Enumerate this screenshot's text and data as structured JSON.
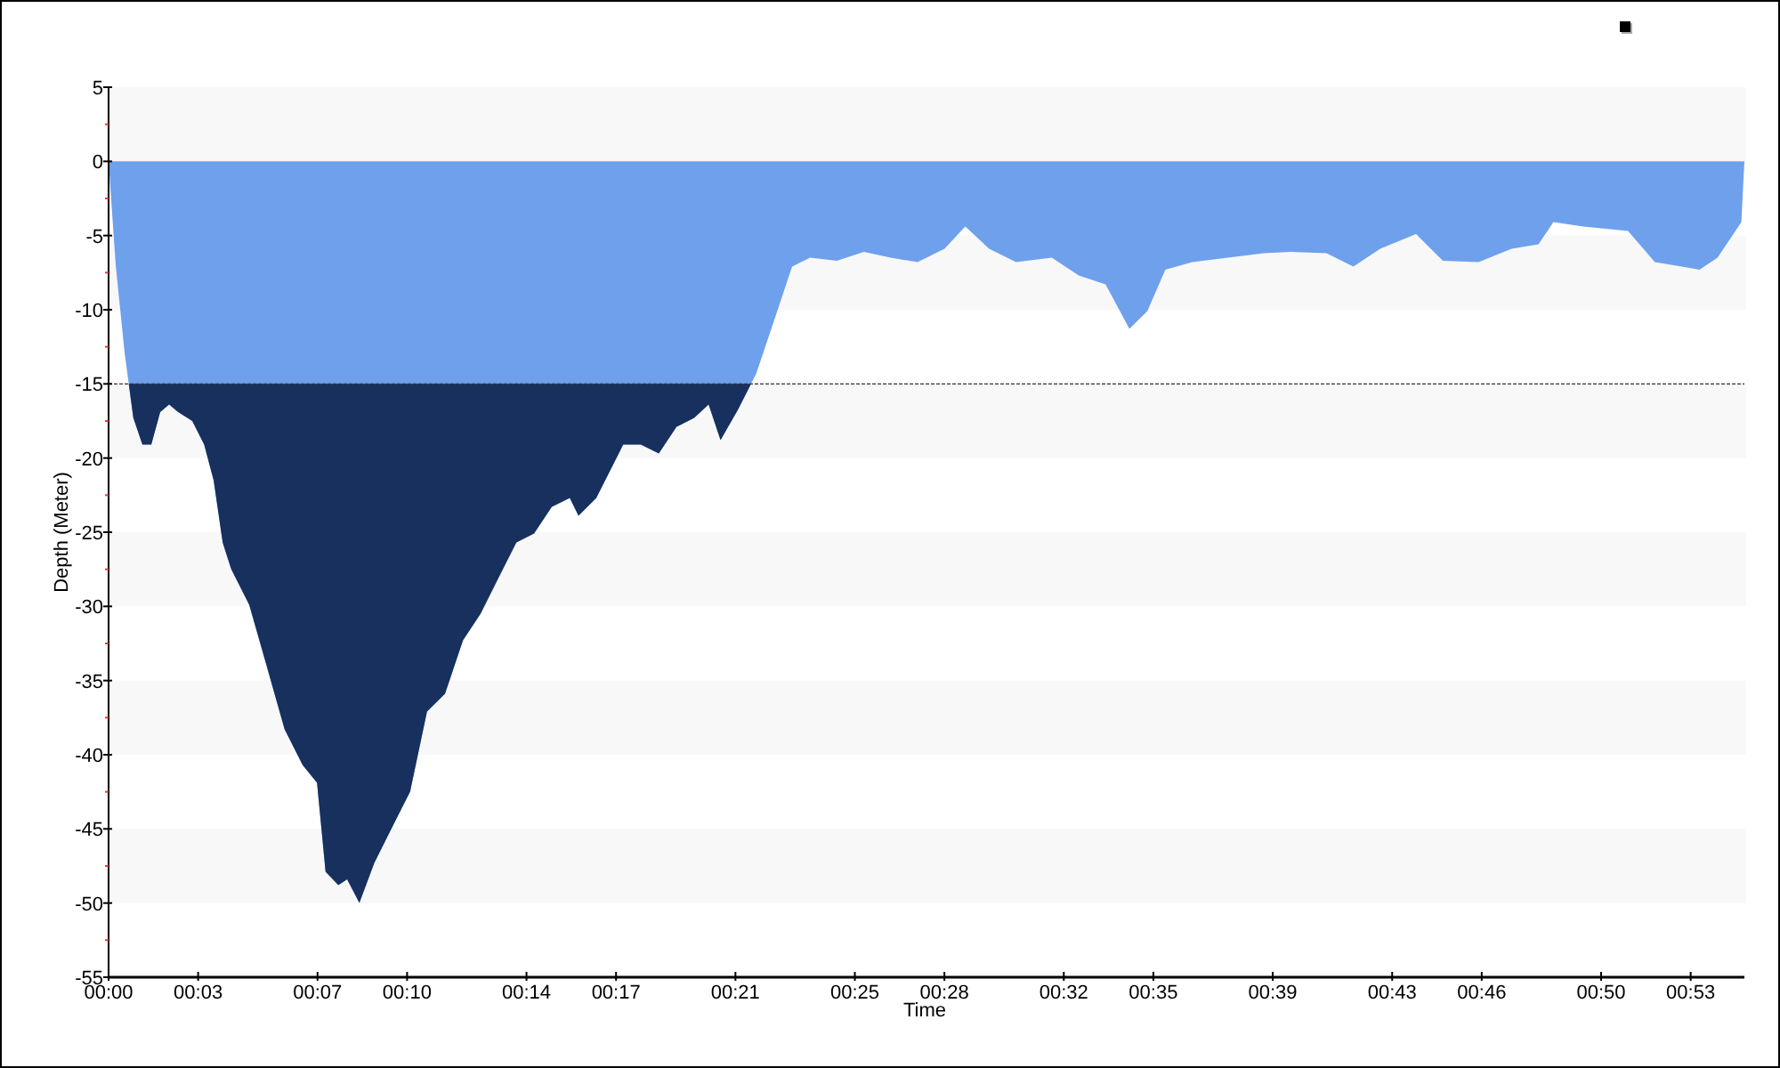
{
  "chart_data": {
    "type": "area",
    "xlabel": "Time",
    "ylabel": "Depth (Meter)",
    "x": [
      0,
      0.24,
      0.54,
      0.83,
      1.13,
      1.43,
      1.73,
      2.03,
      2.33,
      2.8,
      3.2,
      3.52,
      3.82,
      4.11,
      4.71,
      5.31,
      5.9,
      6.5,
      6.98,
      7.27,
      7.7,
      7.99,
      8.4,
      8.9,
      9.5,
      10.1,
      10.67,
      11.27,
      11.87,
      12.46,
      13.06,
      13.66,
      14.25,
      14.85,
      15.45,
      15.74,
      16.34,
      16.94,
      17.24,
      17.83,
      18.43,
      19.03,
      19.62,
      20.1,
      20.5,
      21.1,
      21.7,
      22.3,
      22.9,
      23.5,
      24.4,
      25.3,
      26.2,
      27.1,
      28,
      28.7,
      29.5,
      30.4,
      31.6,
      32.5,
      33.4,
      34.2,
      34.8,
      35.4,
      36.3,
      37.5,
      38.7,
      39.6,
      40.8,
      41.7,
      42.6,
      43.8,
      44.7,
      45.9,
      47,
      47.9,
      48.4,
      49.4,
      50.9,
      51.8,
      52.7,
      53.3,
      53.9,
      54.7,
      54.8
    ],
    "series": [
      {
        "color": "#6fa0ec",
        "values": [
          0,
          -7,
          -13,
          -17.3,
          -19.1,
          -19.1,
          -16.9,
          -16.4,
          -16.9,
          -17.5,
          -19.1,
          -21.5,
          -25.7,
          -27.5,
          -29.9,
          -34.1,
          -38.3,
          -40.7,
          -41.9,
          -47.9,
          -48.8,
          -48.4,
          -50,
          -47.3,
          -44.9,
          -42.5,
          -37.1,
          -35.9,
          -32.3,
          -30.5,
          -28.1,
          -25.7,
          -25.1,
          -23.3,
          -22.7,
          -23.9,
          -22.7,
          -20.3,
          -19.1,
          -19.1,
          -19.7,
          -17.9,
          -17.3,
          -16.4,
          -18.8,
          -16.7,
          -14.3,
          -10.7,
          -7.1,
          -6.5,
          -6.7,
          -6.1,
          -6.5,
          -6.8,
          -5.9,
          -4.4,
          -5.9,
          -6.8,
          -6.5,
          -7.7,
          -8.3,
          -11.3,
          -10.1,
          -7.3,
          -6.8,
          -6.5,
          -6.2,
          -6.1,
          -6.2,
          -7.1,
          -5.9,
          -4.9,
          -6.7,
          -6.8,
          -5.9,
          -5.6,
          -4.1,
          -4.4,
          -4.7,
          -6.8,
          -7.1,
          -7.3,
          -6.5,
          -4.1,
          0
        ]
      }
    ],
    "xlim": [
      0,
      54.8
    ],
    "ylim": [
      -55,
      5
    ],
    "xticks": [
      {
        "value": 0,
        "label": "00:00"
      },
      {
        "value": 3,
        "label": "00:03"
      },
      {
        "value": 7,
        "label": "00:07"
      },
      {
        "value": 10,
        "label": "00:10"
      },
      {
        "value": 14,
        "label": "00:14"
      },
      {
        "value": 17,
        "label": "00:17"
      },
      {
        "value": 21,
        "label": "00:21"
      },
      {
        "value": 25,
        "label": "00:25"
      },
      {
        "value": 28,
        "label": "00:28"
      },
      {
        "value": 32,
        "label": "00:32"
      },
      {
        "value": 35,
        "label": "00:35"
      },
      {
        "value": 39,
        "label": "00:39"
      },
      {
        "value": 43,
        "label": "00:43"
      },
      {
        "value": 46,
        "label": "00:46"
      },
      {
        "value": 50,
        "label": "00:50"
      },
      {
        "value": 53,
        "label": "00:53"
      }
    ],
    "yticks": [
      5,
      0,
      -5,
      -10,
      -15,
      -20,
      -25,
      -30,
      -35,
      -40,
      -45,
      -50,
      -55
    ],
    "ref_lines": [
      {
        "axis": "y",
        "value": -15,
        "color": "#333333"
      }
    ]
  }
}
